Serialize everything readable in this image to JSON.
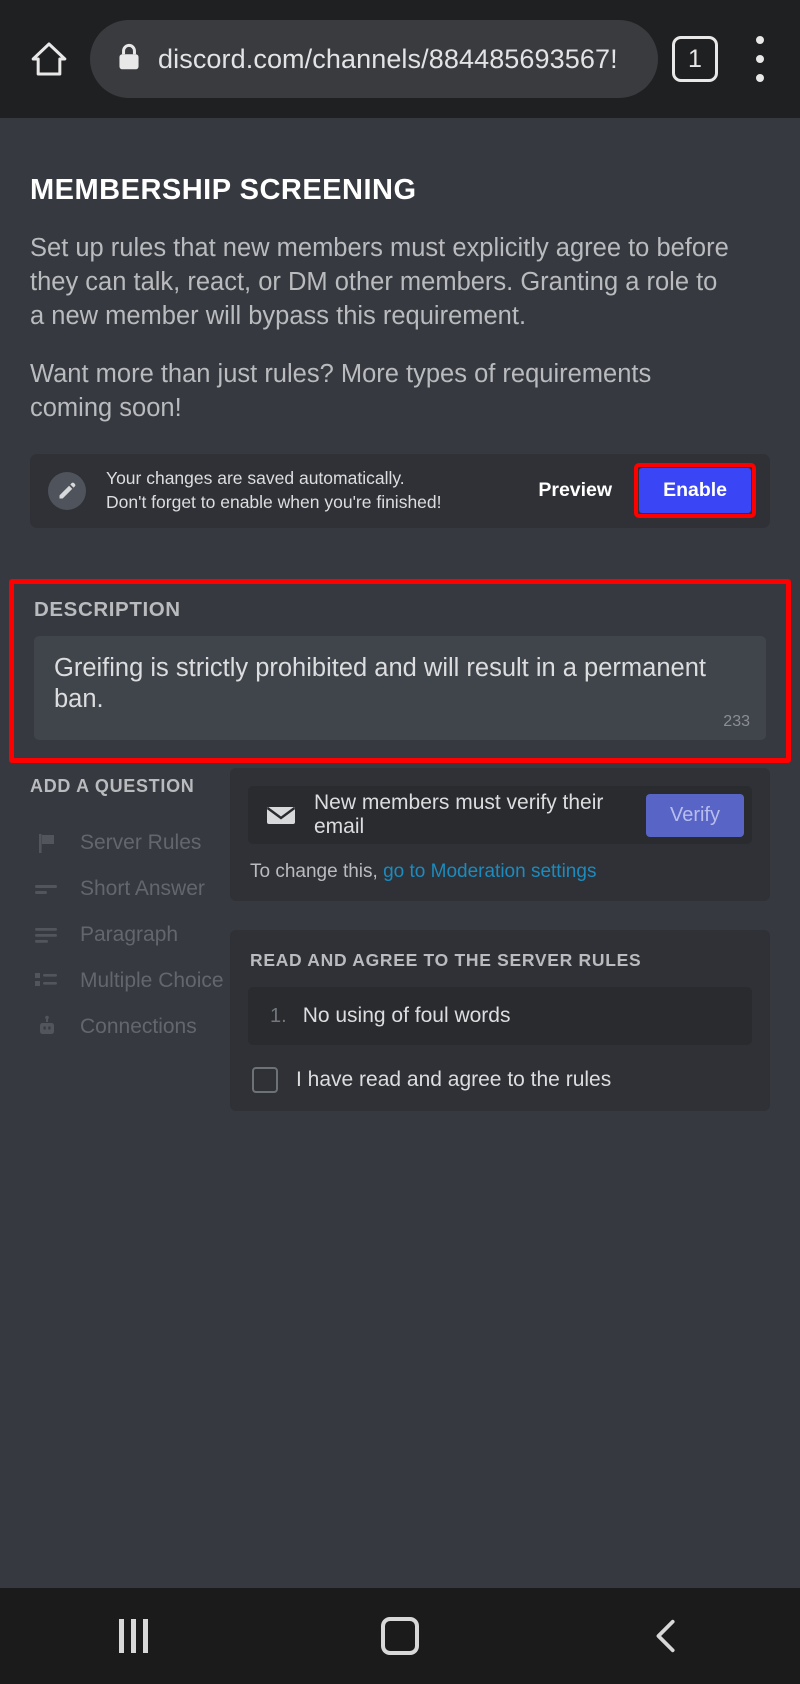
{
  "browser": {
    "home_icon": "home-icon",
    "lock_icon": "lock-icon",
    "url": "discord.com/channels/884485693567!",
    "tab_count": "1",
    "menu_icon": "kebab-menu-icon"
  },
  "page": {
    "title": "MEMBERSHIP SCREENING",
    "paragraph1": "Set up rules that new members must explicitly agree to before they can talk, react, or DM other members. Granting a role to a new member will bypass this requirement.",
    "paragraph2": "Want more than just rules? More types of requirements coming soon!"
  },
  "save_bar": {
    "icon": "pencil-icon",
    "line1": "Your changes are saved automatically.",
    "line2": "Don't forget to enable when you're finished!",
    "preview_label": "Preview",
    "enable_label": "Enable",
    "enable_color": "#3a45f5",
    "highlight_color": "#ff0000"
  },
  "description": {
    "label": "DESCRIPTION",
    "value": "Greifing is strictly prohibited and will result in a permanent ban.",
    "char_count": "233",
    "highlight_color": "#ff0000"
  },
  "add_question": {
    "title": "ADD A QUESTION",
    "items": [
      {
        "label": "Server Rules",
        "icon": "flag-icon"
      },
      {
        "label": "Short Answer",
        "icon": "short-answer-icon"
      },
      {
        "label": "Paragraph",
        "icon": "paragraph-icon"
      },
      {
        "label": "Multiple Choice",
        "icon": "list-icon"
      },
      {
        "label": "Connections",
        "icon": "robot-icon"
      }
    ]
  },
  "email_card": {
    "icon": "envelope-icon",
    "label": "New members must verify their email",
    "button_label": "Verify",
    "button_color": "#5865c6",
    "change_prefix": "To change this, ",
    "change_link": "go to Moderation settings",
    "link_color": "#1c8bbd"
  },
  "rules_card": {
    "title": "READ AND AGREE TO THE SERVER RULES",
    "rules": [
      {
        "number": "1.",
        "text": "No using of foul words"
      }
    ],
    "agree_label": "I have read and agree to the rules"
  },
  "navbar": {
    "recents_icon": "recents-icon",
    "home_icon": "home-square-icon",
    "back_icon": "back-chevron-icon"
  }
}
